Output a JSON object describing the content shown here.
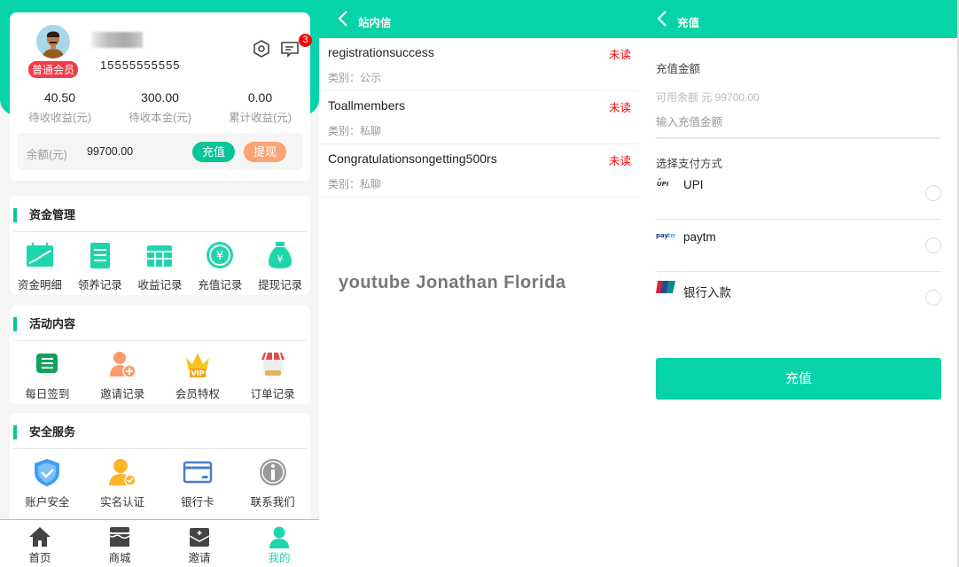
{
  "colors": {
    "accent": "#07d3a8",
    "badge_red": "#f23a48",
    "withdraw": "#fda374",
    "recharge_btn": "#07c597"
  },
  "profile": {
    "level_badge": "普通会员",
    "phone": "15555555555",
    "message_count": "3",
    "stats": [
      {
        "value": "40.50",
        "label": "待收收益(元)"
      },
      {
        "value": "300.00",
        "label": "待收本金(元)"
      },
      {
        "value": "0.00",
        "label": "累计收益(元)"
      }
    ],
    "balance_label": "余额(元)",
    "balance_value": "99700.00",
    "recharge": "充值",
    "withdraw": "提现"
  },
  "funds": {
    "title": "资金管理",
    "items": [
      {
        "label": "资金明细",
        "icon": "chart-calendar-icon"
      },
      {
        "label": "领养记录",
        "icon": "clipboard-list-icon"
      },
      {
        "label": "收益记录",
        "icon": "calendar-icon"
      },
      {
        "label": "充值记录",
        "icon": "yen-coin-icon"
      },
      {
        "label": "提现记录",
        "icon": "money-bag-icon"
      }
    ]
  },
  "activity": {
    "title": "活动内容",
    "items": [
      {
        "label": "每日签到",
        "icon": "list-icon"
      },
      {
        "label": "邀请记录",
        "icon": "add-user-icon"
      },
      {
        "label": "会员特权",
        "icon": "vip-crown-icon"
      },
      {
        "label": "订单记录",
        "icon": "shop-icon"
      }
    ]
  },
  "security": {
    "title": "安全服务",
    "items": [
      {
        "label": "账户安全",
        "icon": "shield-check-icon"
      },
      {
        "label": "实名认证",
        "icon": "user-verified-icon"
      },
      {
        "label": "银行卡",
        "icon": "credit-card-icon"
      },
      {
        "label": "联系我们",
        "icon": "info-icon"
      }
    ]
  },
  "nav": [
    {
      "label": "首页",
      "icon": "home-icon"
    },
    {
      "label": "商城",
      "icon": "store-icon"
    },
    {
      "label": "邀请",
      "icon": "envelope-icon"
    },
    {
      "label": "我的",
      "icon": "user-icon",
      "active": true
    }
  ],
  "messages": {
    "title": "站内信",
    "items": [
      {
        "title": "registrationsuccess",
        "status": "未读",
        "category": "类别：公示"
      },
      {
        "title": "Toallmembers",
        "status": "未读",
        "category": "类别：私聊"
      },
      {
        "title": "Congratulationsongetting500rs",
        "status": "未读",
        "category": "类别：私聊"
      }
    ],
    "watermark": "youtube Jonathan Florida"
  },
  "recharge": {
    "title": "充值",
    "amount_label": "充值金额",
    "available": "可用余额 元 99700.00",
    "amount_placeholder": "输入充值金额",
    "method_label": "选择支付方式",
    "methods": [
      {
        "name": "UPI",
        "icon": "upi-icon"
      },
      {
        "name": "paytm",
        "icon": "paytm-icon"
      },
      {
        "name": "银行入款",
        "icon": "unionpay-icon"
      }
    ],
    "submit": "充值"
  }
}
